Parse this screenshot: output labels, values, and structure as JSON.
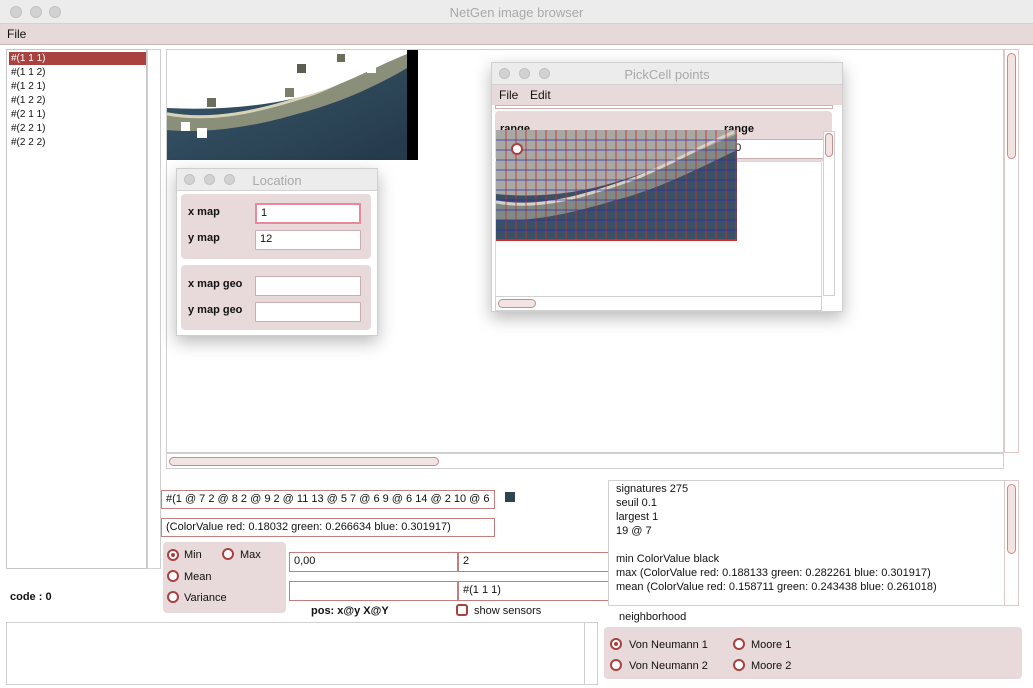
{
  "window": {
    "title": "NetGen image browser"
  },
  "menubar": {
    "file": "File"
  },
  "list": {
    "items": [
      "#(1 1 1)",
      "#(1 1 2)",
      "#(1 2 1)",
      "#(1 2 2)",
      "#(2 1 1)",
      "#(2 2 1)",
      "#(2 2 2)"
    ],
    "selected": 0
  },
  "code": "code : 0",
  "location": {
    "title": "Location",
    "x_map_label": "x map",
    "x_map_value": "1",
    "y_map_label": "y map",
    "y_map_value": "12",
    "x_geo_label": "x map geo",
    "x_geo_value": "",
    "y_geo_label": "y map geo",
    "y_geo_value": ""
  },
  "pickcell": {
    "title": "PickCell points",
    "menu_file": "File",
    "menu_edit": "Edit",
    "range_label_left": "range",
    "range_label_right": "range",
    "range_value": "20"
  },
  "signature_field": "#(1 @ 7 2 @ 8 2 @ 9 2 @ 11 13 @ 5 7 @ 6 9 @ 6 14 @ 2 10 @ 6",
  "color_field": "(ColorValue red: 0.18032 green: 0.266634 blue: 0.301917)",
  "swatch_color": "#2e4550",
  "stats": {
    "options": [
      {
        "label": "Min",
        "checked": true
      },
      {
        "label": "Max",
        "checked": false
      },
      {
        "label": "Mean",
        "checked": false
      },
      {
        "label": "Variance",
        "checked": false
      }
    ]
  },
  "coord_field": "0,00",
  "value_field": "2",
  "empty_field": "",
  "cell_field": "#(1 1 1)",
  "pos_label": "pos: x@y X@Y",
  "show_sensors": {
    "label": "show sensors",
    "checked": false
  },
  "info": {
    "signatures": "signatures  275",
    "seuil": "seuil  0.1",
    "largest": "largest  1",
    "pos": "19 @ 7",
    "min": "min ColorValue black",
    "max": "max (ColorValue red: 0.188133 green: 0.282261 blue: 0.301917)",
    "mean": "mean (ColorValue red: 0.158711 green: 0.243438 blue: 0.261018)"
  },
  "neighborhood": {
    "title": "neighborhood",
    "options": [
      {
        "label": "Von Neumann 1",
        "checked": true
      },
      {
        "label": "Moore 1",
        "checked": false
      },
      {
        "label": "Von Neumann 2",
        "checked": false
      },
      {
        "label": "Moore 2",
        "checked": false
      }
    ]
  },
  "colors": {
    "accent": "#a9413f",
    "panel": "#e8dada",
    "menubar": "#e5d9d9",
    "selection": "#a9413f"
  }
}
